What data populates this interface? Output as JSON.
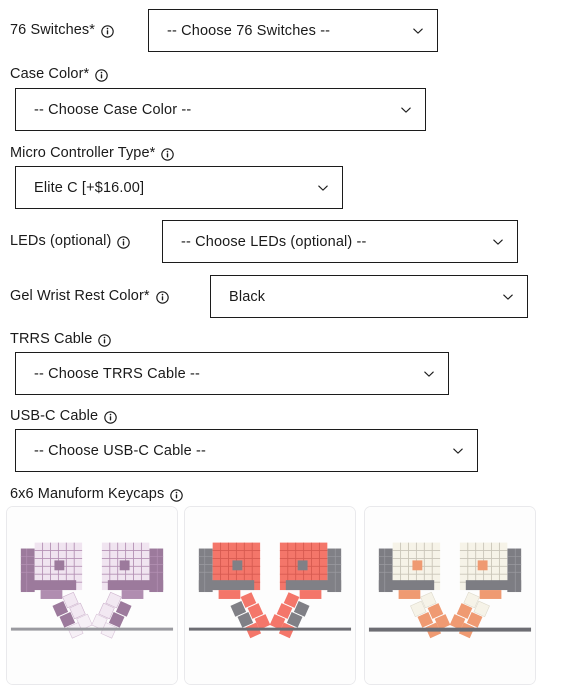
{
  "form": {
    "fields": [
      {
        "label": "76 Switches*",
        "info_icon": "info-icon",
        "value": "-- Choose 76 Switches --",
        "layout": "inline",
        "name": "switches-76"
      },
      {
        "label": "Case Color*",
        "info_icon": "info-icon",
        "value": "-- Choose Case Color --",
        "layout": "stacked",
        "name": "case-color"
      },
      {
        "label": "Micro Controller Type*",
        "info_icon": "info-icon",
        "value": "Elite C [+$16.00]",
        "layout": "stacked",
        "name": "micro-controller-type"
      },
      {
        "label": "LEDs (optional)",
        "info_icon": "info-icon",
        "value": "-- Choose LEDs (optional) --",
        "layout": "inline",
        "name": "leds"
      },
      {
        "label": "Gel Wrist Rest Color*",
        "info_icon": "info-icon",
        "value": "Black",
        "layout": "inline",
        "name": "gel-wrist-rest-color"
      },
      {
        "label": "TRRS Cable",
        "info_icon": "info-icon",
        "value": "-- Choose TRRS Cable --",
        "layout": "stacked",
        "name": "trrs-cable"
      },
      {
        "label": "USB-C Cable",
        "info_icon": "info-icon",
        "value": "-- Choose USB-C Cable --",
        "layout": "stacked",
        "name": "usb-c-cable"
      }
    ],
    "keycaps": {
      "label": "6x6 Manuform Keycaps",
      "info_icon": "info-icon",
      "options": [
        {
          "name": "keycap-option-purple",
          "key_color": "#b491b4",
          "accent_color": "#e8d8e8",
          "body_color": "#9c7a9c",
          "alt_color": "#f4ecf4"
        },
        {
          "name": "keycap-option-red",
          "key_color": "#f4766a",
          "accent_color": "#f9958a",
          "body_color": "#808086",
          "alt_color": "#fa9a8f"
        },
        {
          "name": "keycap-option-cream",
          "key_color": "#f2efe4",
          "accent_color": "#ef9a72",
          "body_color": "#7d7d83",
          "alt_color": "#fbf8ef"
        }
      ]
    }
  },
  "colors": {
    "text": "#1a1a1a",
    "border": "#1c1c1c",
    "card_border": "#e9e9ec",
    "desk": "#9a9aa0",
    "background": "#ffffff"
  }
}
